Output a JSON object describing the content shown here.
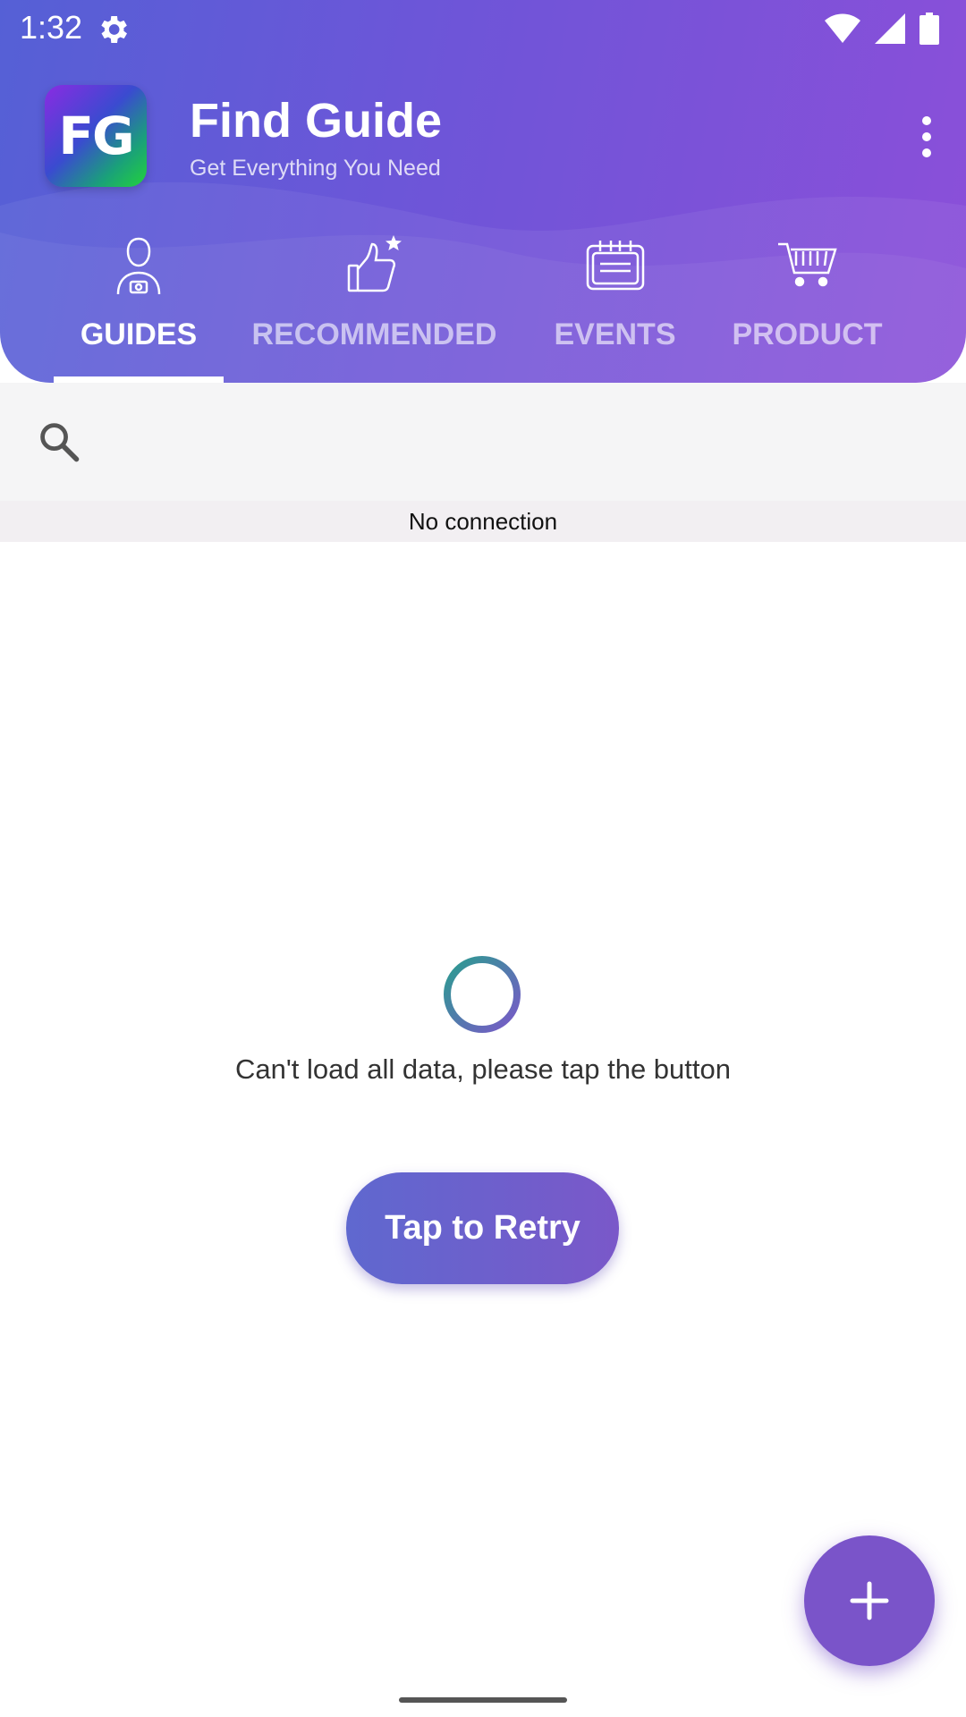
{
  "status_bar": {
    "time": "1:32",
    "icons": [
      "gear-icon",
      "wifi-icon",
      "signal-icon",
      "battery-icon"
    ]
  },
  "app_bar": {
    "logo_text": "FG",
    "title": "Find Guide",
    "subtitle": "Get Everything You Need",
    "menu_icon": "overflow-menu-icon"
  },
  "tabs": [
    {
      "label": "GUIDES",
      "icon": "guide-person-icon",
      "active": true
    },
    {
      "label": "RECOMMENDED",
      "icon": "thumbs-up-star-icon",
      "active": false
    },
    {
      "label": "EVENTS",
      "icon": "calendar-icon",
      "active": false
    },
    {
      "label": "PRODUCT",
      "icon": "cart-icon",
      "active": false
    }
  ],
  "search": {
    "placeholder": "",
    "value": "",
    "icon": "search-icon"
  },
  "banner": {
    "no_connection": "No connection"
  },
  "content": {
    "error_message": "Can't load all data, please tap the button",
    "retry_label": "Tap to Retry",
    "spinner_icon": "loading-spinner-icon"
  },
  "fab": {
    "icon": "plus-icon"
  },
  "colors": {
    "header_start": "#5560d6",
    "header_end": "#8b4fd9",
    "accent": "#7a54c9",
    "banner_bg": "#f2eff2"
  }
}
